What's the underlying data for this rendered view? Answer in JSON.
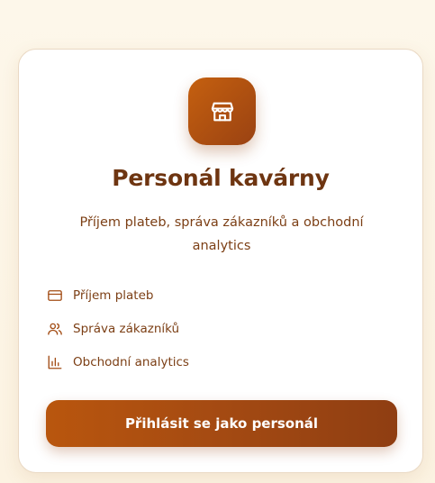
{
  "card": {
    "logo_icon": "store-icon",
    "title": "Personál kavárny",
    "subtitle": "Příjem plateb, správa zákazníků a obchodní analytics",
    "features": [
      {
        "icon": "credit-card-icon",
        "label": "Příjem plateb"
      },
      {
        "icon": "users-icon",
        "label": "Správa zákazníků"
      },
      {
        "icon": "bar-chart-icon",
        "label": "Obchodní analytics"
      }
    ],
    "login_button": "Přihlásit se jako personál"
  },
  "colors": {
    "accent": "#b3550f",
    "accent_dark": "#8f3e12",
    "text": "#7c3f15",
    "title": "#6e3511",
    "background": "#fdf7ea"
  }
}
